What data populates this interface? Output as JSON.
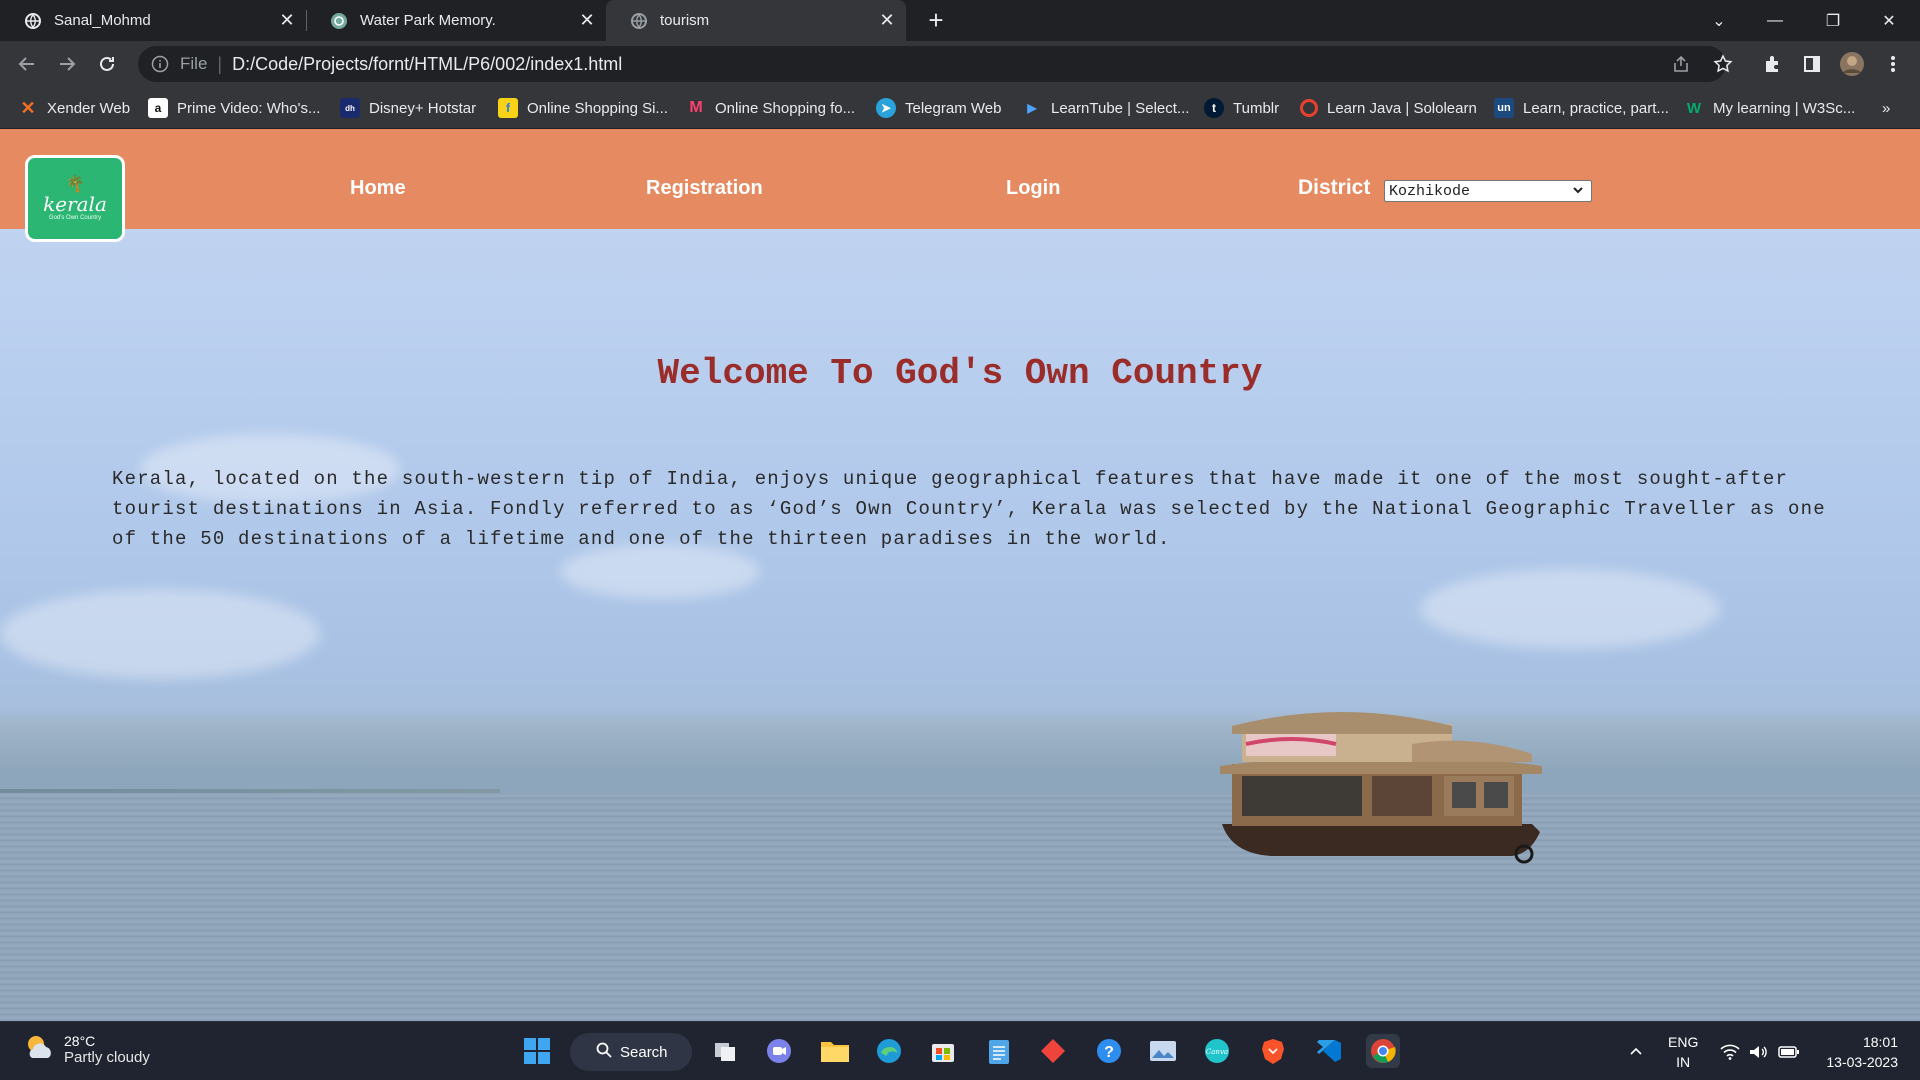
{
  "browser": {
    "tabs": [
      {
        "title": "Sanal_Mohmd",
        "active": false,
        "favicon": "globe-icon"
      },
      {
        "title": "Water Park Memory.",
        "active": false,
        "favicon": "chatgpt-icon"
      },
      {
        "title": "tourism",
        "active": true,
        "favicon": "globe-icon"
      }
    ],
    "address": {
      "scheme": "File",
      "url": "D:/Code/Projects/fornt/HTML/P6/002/index1.html"
    },
    "bookmarks": [
      {
        "label": "Xender Web",
        "icon": "xender-icon",
        "color": "#f36f21"
      },
      {
        "label": "Prime Video: Who's...",
        "icon": "amazon-icon",
        "color": "#ffffff"
      },
      {
        "label": "Disney+ Hotstar",
        "icon": "hotstar-icon",
        "color": "#1a2b6d"
      },
      {
        "label": "Online Shopping Si...",
        "icon": "flipkart-icon",
        "color": "#f7d216"
      },
      {
        "label": "Online Shopping fo...",
        "icon": "myntra-icon",
        "color": "#ff3f6c"
      },
      {
        "label": "Telegram Web",
        "icon": "telegram-icon",
        "color": "#2aa3dc"
      },
      {
        "label": "LearnTube | Select...",
        "icon": "learntube-icon",
        "color": "#2d6cdf"
      },
      {
        "label": "Tumblr",
        "icon": "tumblr-icon",
        "color": "#001935"
      },
      {
        "label": "Learn Java | Sololearn",
        "icon": "sololearn-icon",
        "color": "#e8412d"
      },
      {
        "label": "Learn, practice, part...",
        "icon": "unstop-icon",
        "color": "#1c4980"
      },
      {
        "label": "My learning | W3Sc...",
        "icon": "w3schools-icon",
        "color": "#04aa6d"
      }
    ]
  },
  "site": {
    "logo": {
      "text": "kerala",
      "tagline": "God's Own Country"
    },
    "nav": {
      "home": "Home",
      "registration": "Registration",
      "login": "Login"
    },
    "district": {
      "label": "District",
      "selected": "Kozhikode"
    },
    "heading": "Welcome To God's Own Country",
    "intro": "Kerala, located on the south-western tip of India, enjoys unique geographical features that have made it one of the most sought-after tourist destinations in Asia. Fondly referred to as ‘God’s Own Country’, Kerala was selected by the National Geographic Traveller as one of the 50 destinations of a lifetime and one of the thirteen paradises in the world.",
    "colors": {
      "navbar": "#e58a61",
      "heading": "#9a2d2a",
      "logo_bg": "#2bb673"
    }
  },
  "taskbar": {
    "weather": {
      "temp": "28°C",
      "condition": "Partly cloudy"
    },
    "search_label": "Search",
    "language": {
      "line1": "ENG",
      "line2": "IN"
    },
    "clock": {
      "time": "18:01",
      "date": "13-03-2023"
    }
  }
}
